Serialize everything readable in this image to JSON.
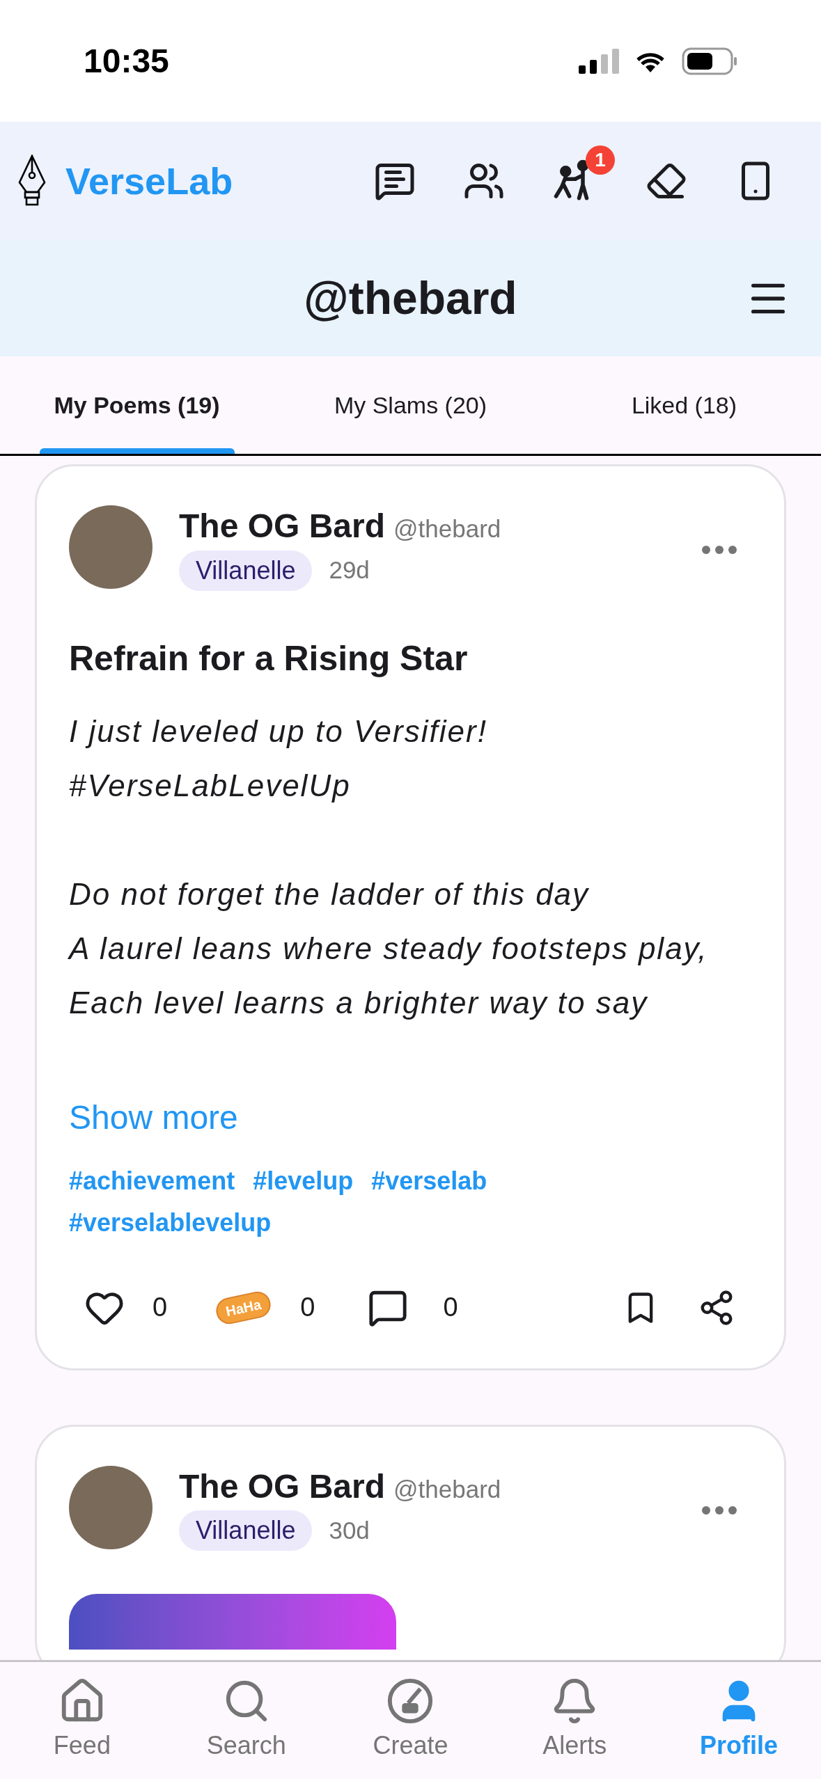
{
  "status_bar": {
    "time": "10:35"
  },
  "app_header": {
    "logo_text": "VerseLab",
    "notification_badge": "1"
  },
  "title_bar": {
    "title": "@thebard"
  },
  "tabs": [
    {
      "label": "My Poems (19)",
      "selected": true
    },
    {
      "label": "My Slams (20)",
      "selected": false
    },
    {
      "label": "Liked (18)",
      "selected": false
    }
  ],
  "posts": [
    {
      "author": "The OG Bard",
      "handle": "@thebard",
      "form": "Villanelle",
      "age": "29d",
      "title": "Refrain for a Rising Star",
      "stanzas": [
        [
          "I just leveled up to Versifier!",
          "#VerseLabLevelUp"
        ],
        [
          "Do not forget the ladder of this day",
          "A laurel leans where steady footsteps play,",
          "Each level learns a brighter way to say"
        ]
      ],
      "show_more": "Show more",
      "tags": [
        "#achievement",
        "#levelup",
        "#verselab",
        "#verselablevelup"
      ],
      "likes": "0",
      "reaction_sticker": "HaHa",
      "reactions": "0",
      "comments": "0"
    },
    {
      "author": "The OG Bard",
      "handle": "@thebard",
      "form": "Villanelle",
      "age": "30d"
    }
  ],
  "bottom_nav": [
    {
      "label": "Feed",
      "selected": false
    },
    {
      "label": "Search",
      "selected": false
    },
    {
      "label": "Create",
      "selected": false
    },
    {
      "label": "Alerts",
      "selected": false
    },
    {
      "label": "Profile",
      "selected": true
    }
  ]
}
